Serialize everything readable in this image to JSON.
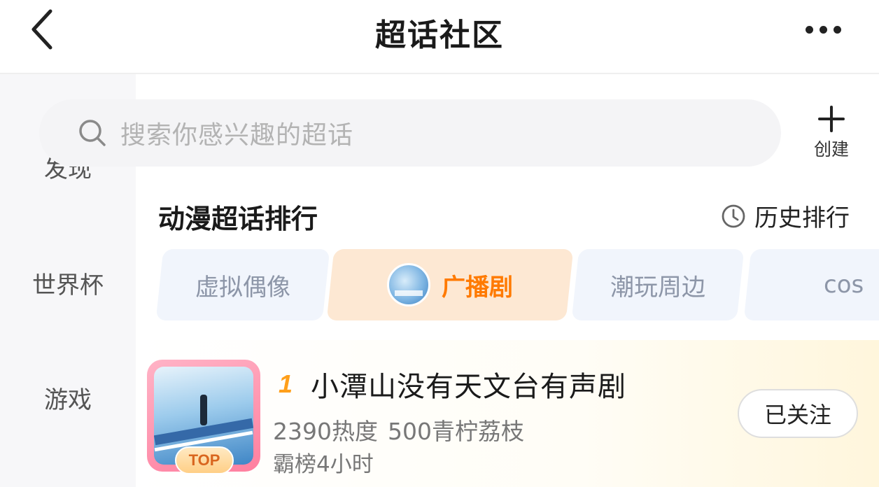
{
  "header": {
    "title": "超话社区",
    "back_icon": "chevron-left-icon",
    "more_icon": "more-dots-icon"
  },
  "search": {
    "placeholder": "搜索你感兴趣的超话",
    "icon": "search-icon"
  },
  "create": {
    "label": "创建",
    "icon": "plus-icon"
  },
  "sidebar": {
    "items": [
      {
        "label": "发现"
      },
      {
        "label": "世界杯"
      },
      {
        "label": "游戏"
      }
    ]
  },
  "section": {
    "title": "动漫超话排行",
    "history_label": "历史排行",
    "history_icon": "clock-icon"
  },
  "tabs": [
    {
      "label": "虚拟偶像",
      "active": false
    },
    {
      "label": "广播剧",
      "active": true
    },
    {
      "label": "潮玩周边",
      "active": false
    },
    {
      "label": "cos",
      "active": false
    }
  ],
  "ranking": [
    {
      "rank": "1",
      "name": "小潭山没有天文台有声剧",
      "heat": "2390热度",
      "lychee": "500青柠荔枝",
      "sub": "霸榜4小时",
      "badge": "TOP",
      "follow_label": "已关注"
    }
  ],
  "colors": {
    "accent": "#ff7a00",
    "active_tab_bg": "#fde8d3",
    "tab_bg": "#f1f5fc",
    "sidebar_bg": "#f7f7f9"
  }
}
